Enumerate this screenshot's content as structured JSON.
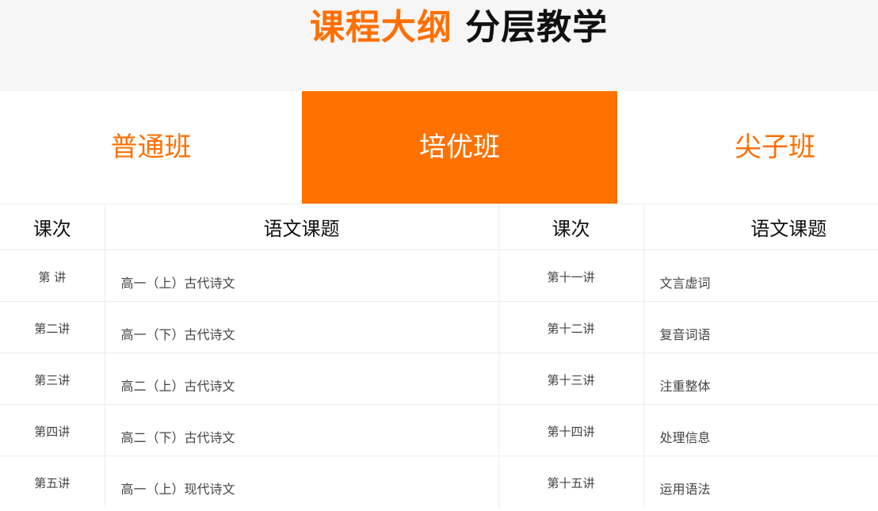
{
  "header": {
    "title_accent": "课程大纲",
    "title_rest": "分层教学"
  },
  "tabs": [
    {
      "label": "普通班",
      "active": false
    },
    {
      "label": "培优班",
      "active": true
    },
    {
      "label": "尖子班",
      "active": false
    }
  ],
  "colors": {
    "accent": "#ff7100",
    "header_bg": "#f6f6f6"
  },
  "table": {
    "headers": [
      "课次",
      "语文课题",
      "课次",
      "语文课题"
    ],
    "rows": [
      {
        "left_num": "第 讲",
        "left_topic": "高一（上）古代诗文",
        "right_num": "第十一讲",
        "right_topic": "文言虚词"
      },
      {
        "left_num": "第二讲",
        "left_topic": "高一（下）古代诗文",
        "right_num": "第十二讲",
        "right_topic": "复音词语"
      },
      {
        "left_num": "第三讲",
        "left_topic": "高二（上）古代诗文",
        "right_num": "第十三讲",
        "right_topic": "注重整体"
      },
      {
        "left_num": "第四讲",
        "left_topic": "高二（下）古代诗文",
        "right_num": "第十四讲",
        "right_topic": "处理信息"
      },
      {
        "left_num": "第五讲",
        "left_topic": "高一（上）现代诗文",
        "right_num": "第十五讲",
        "right_topic": "运用语法"
      }
    ]
  }
}
